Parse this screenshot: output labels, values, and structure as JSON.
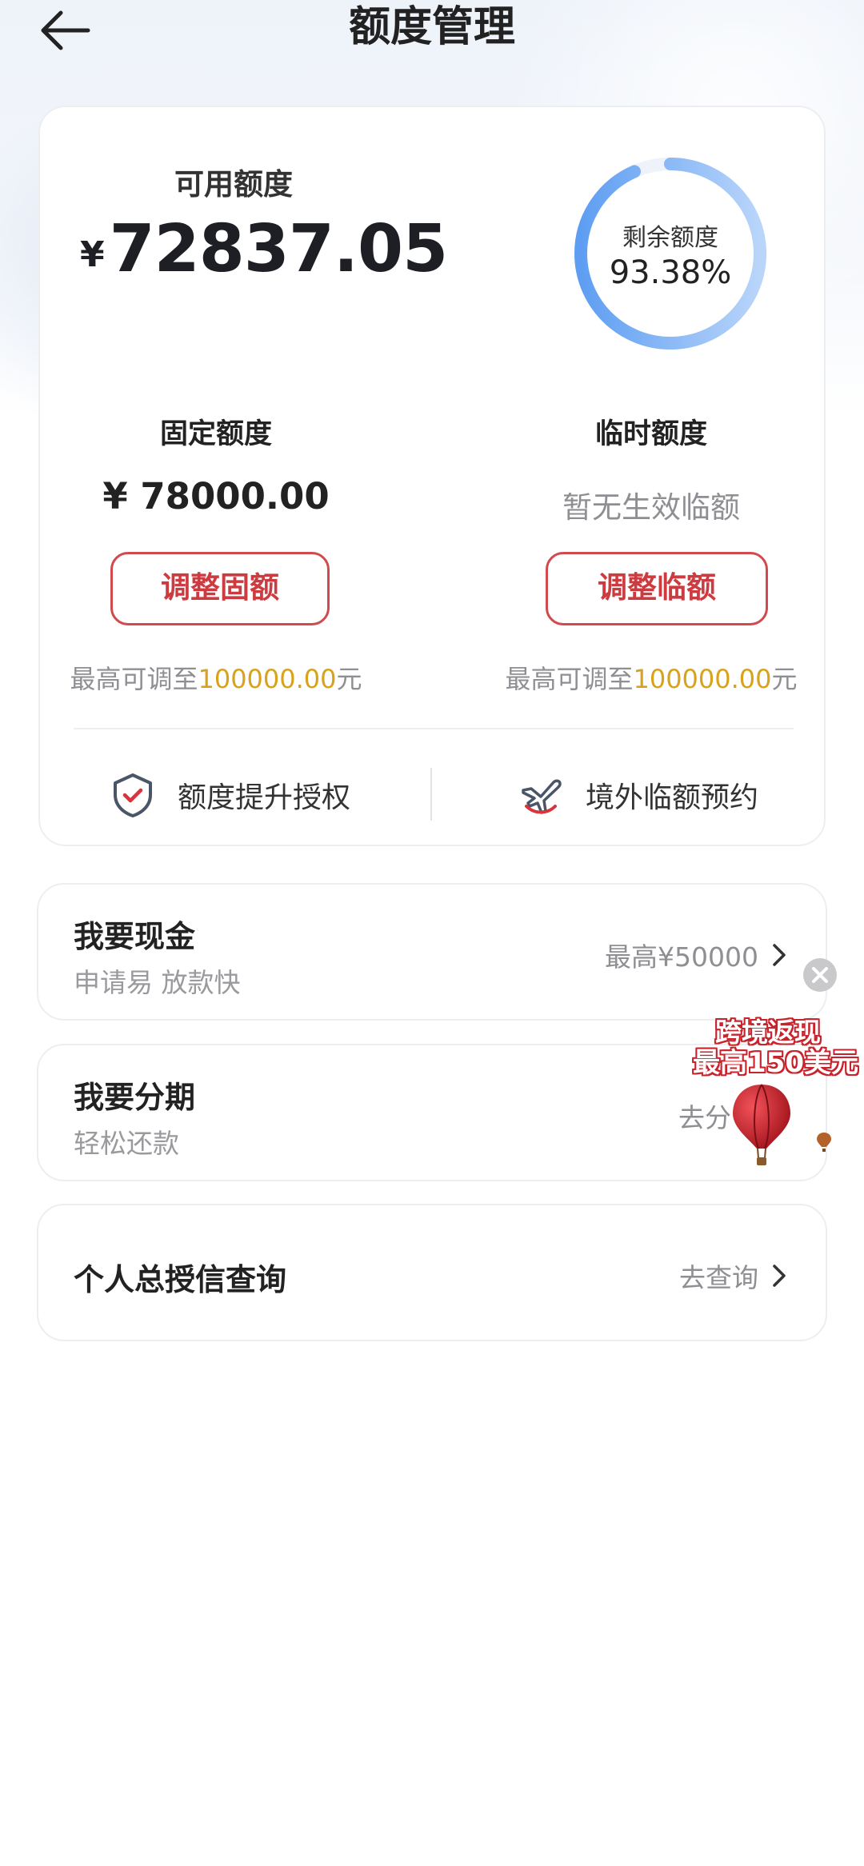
{
  "header": {
    "title": "额度管理",
    "back_icon": "back-arrow-icon"
  },
  "available": {
    "label": "可用额度",
    "currency": "¥",
    "amount": "72837.05"
  },
  "remaining": {
    "label": "剩余额度",
    "value": "93.38%",
    "fraction": 0.9338,
    "ring_color": "#6ea8f5"
  },
  "fixed": {
    "label": "固定额度",
    "amount": "¥ 78000.00",
    "button": "调整固额",
    "max_prefix": "最高可调至",
    "max_value": "100000.00",
    "max_suffix": "元"
  },
  "temporary": {
    "label": "临时额度",
    "status": "暂无生效临额",
    "button": "调整临额",
    "max_prefix": "最高可调至",
    "max_value": "100000.00",
    "max_suffix": "元"
  },
  "links": {
    "raise": {
      "label": "额度提升授权",
      "icon": "shield-check-icon"
    },
    "overseas": {
      "label": "境外临额预约",
      "icon": "airplane-icon"
    }
  },
  "items": {
    "cash": {
      "title": "我要现金",
      "subtitle": "申请易 放款快",
      "right": "最高¥50000"
    },
    "installment": {
      "title": "我要分期",
      "subtitle": "轻松还款",
      "right": "去分"
    },
    "credit": {
      "title": "个人总授信查询",
      "right": "去查询"
    }
  },
  "float_ad": {
    "line1": "跨境返现",
    "line2": "最高150美元",
    "icon": "hot-air-balloon-icon"
  },
  "colors": {
    "accent_red": "#cc3b40",
    "gold": "#d9a21c",
    "ring_blue": "#6ea8f5"
  }
}
